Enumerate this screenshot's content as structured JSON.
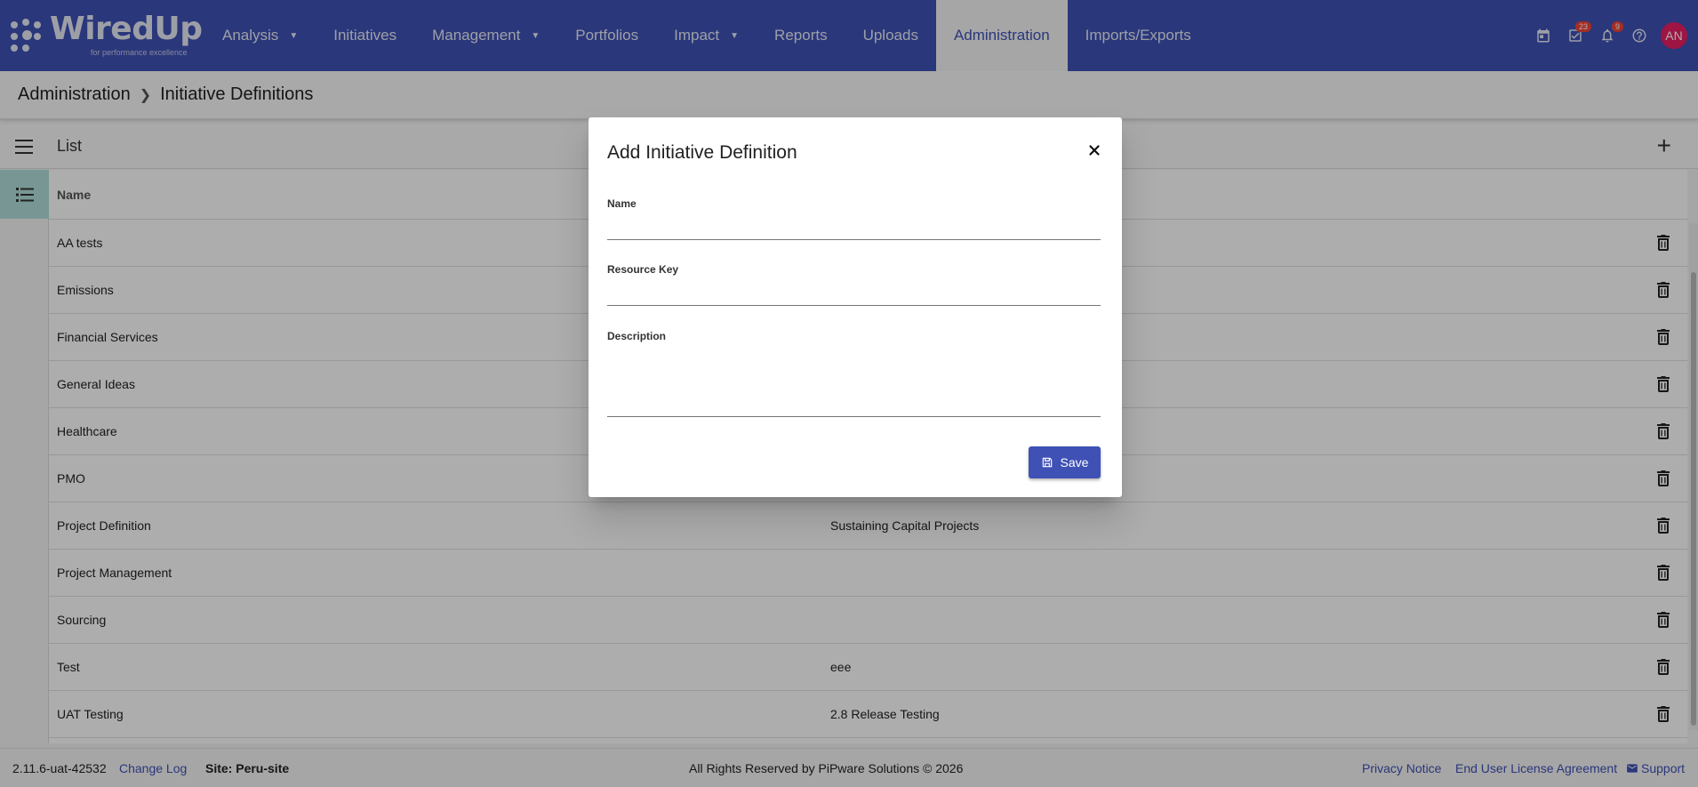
{
  "app": {
    "logo_text": "WiredUp",
    "logo_tagline": "for performance excellence"
  },
  "nav": {
    "items": [
      {
        "label": "Analysis",
        "has_caret": true
      },
      {
        "label": "Initiatives",
        "has_caret": false
      },
      {
        "label": "Management",
        "has_caret": true
      },
      {
        "label": "Portfolios",
        "has_caret": false
      },
      {
        "label": "Impact",
        "has_caret": true
      },
      {
        "label": "Reports",
        "has_caret": false
      },
      {
        "label": "Uploads",
        "has_caret": false
      },
      {
        "label": "Administration",
        "has_caret": false,
        "active": true
      },
      {
        "label": "Imports/Exports",
        "has_caret": false
      }
    ]
  },
  "top_icons": {
    "calendar_icon": "calendar-icon",
    "tasks_badge": "23",
    "notifications_badge": "9",
    "help_icon": "help-icon",
    "avatar_initials": "AN"
  },
  "breadcrumb": {
    "parent": "Administration",
    "current": "Initiative Definitions"
  },
  "list": {
    "title": "List",
    "header_name": "Name",
    "rows": [
      {
        "name": "AA tests",
        "description": ""
      },
      {
        "name": "Emissions",
        "description": ""
      },
      {
        "name": "Financial Services",
        "description": ""
      },
      {
        "name": "General Ideas",
        "description": ""
      },
      {
        "name": "Healthcare",
        "description": ""
      },
      {
        "name": "PMO",
        "description": ""
      },
      {
        "name": "Project Definition",
        "description": "Sustaining Capital Projects"
      },
      {
        "name": "Project Management",
        "description": ""
      },
      {
        "name": "Sourcing",
        "description": ""
      },
      {
        "name": "Test",
        "description": "eee"
      },
      {
        "name": "UAT Testing",
        "description": "2.8 Release Testing"
      }
    ]
  },
  "modal": {
    "title": "Add Initiative Definition",
    "name_label": "Name",
    "name_value": "",
    "resource_key_label": "Resource Key",
    "resource_key_value": "",
    "description_label": "Description",
    "description_value": "",
    "save_label": "Save"
  },
  "footer": {
    "version": "2.11.6-uat-42532",
    "change_log": "Change Log",
    "site": "Site: Peru-site",
    "rights": "All Rights Reserved by PiPware Solutions © 2026",
    "privacy": "Privacy Notice",
    "eula": "End User License Agreement",
    "support": "Support"
  },
  "colors": {
    "primary": "#3f51b5",
    "badge": "#f44336",
    "avatar": "#e91e63",
    "list_icon_bg": "#b2dfdb"
  }
}
